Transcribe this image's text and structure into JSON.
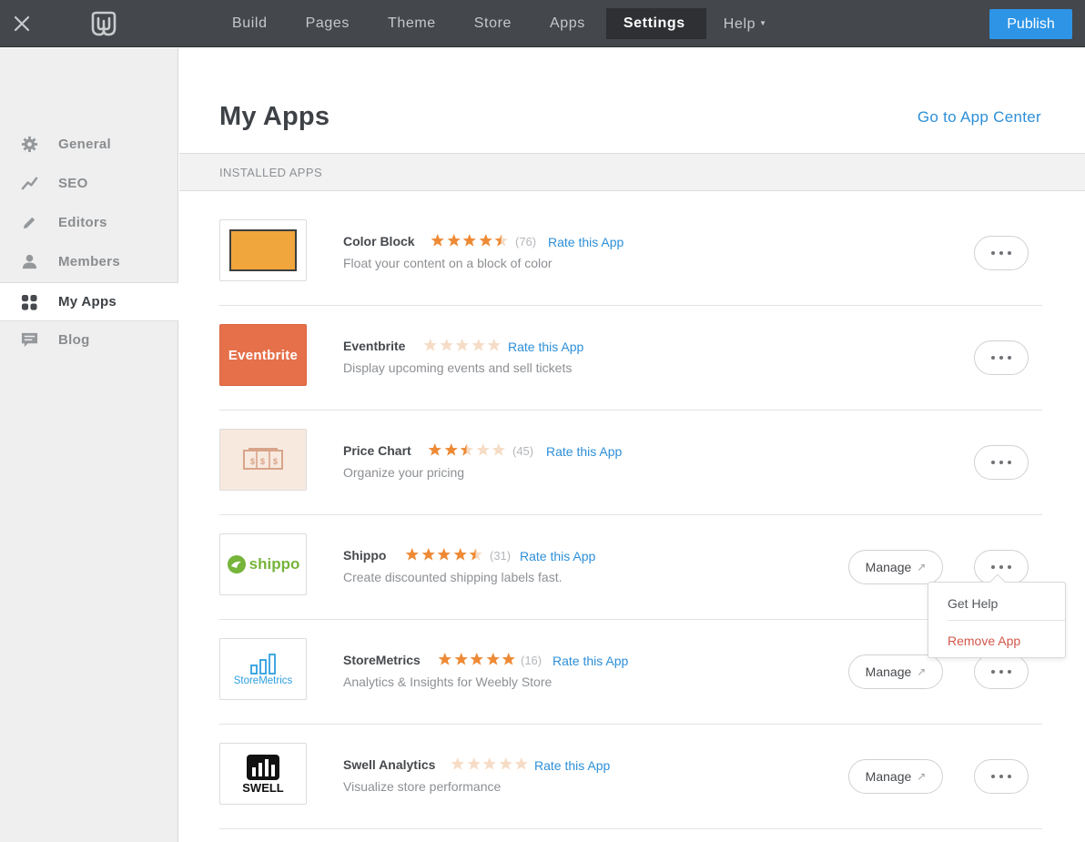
{
  "topbar": {
    "nav": [
      {
        "label": "Build",
        "active": false
      },
      {
        "label": "Pages",
        "active": false
      },
      {
        "label": "Theme",
        "active": false
      },
      {
        "label": "Store",
        "active": false
      },
      {
        "label": "Apps",
        "active": false
      },
      {
        "label": "Settings",
        "active": true
      },
      {
        "label": "Help",
        "active": false
      }
    ],
    "publish_label": "Publish",
    "colors": {
      "bar": "#44474b",
      "publish": "#2d94e6"
    }
  },
  "sidebar": {
    "items": [
      {
        "label": "General",
        "icon": "gear-icon",
        "active": false
      },
      {
        "label": "SEO",
        "icon": "trend-icon",
        "active": false
      },
      {
        "label": "Editors",
        "icon": "pencil-icon",
        "active": false
      },
      {
        "label": "Members",
        "icon": "person-icon",
        "active": false
      },
      {
        "label": "My Apps",
        "icon": "grid-icon",
        "active": true
      },
      {
        "label": "Blog",
        "icon": "speech-bubble-icon",
        "active": false
      }
    ]
  },
  "main": {
    "title": "My Apps",
    "app_center_link": "Go to App Center",
    "section_label": "INSTALLED APPS",
    "apps": [
      {
        "name": "Color Block",
        "rating": 4.5,
        "count": "(76)",
        "rate_label": "Rate this App",
        "description": "Float your content on a block of color",
        "has_manage": false,
        "logo_text": ""
      },
      {
        "name": "Eventbrite",
        "rating": 0,
        "count": "",
        "rate_label": "Rate this App",
        "description": "Display upcoming events and sell tickets",
        "has_manage": false,
        "logo_text": "Eventbrite"
      },
      {
        "name": "Price Chart",
        "rating": 2.5,
        "count": "(45)",
        "rate_label": "Rate this App",
        "description": "Organize your pricing",
        "has_manage": false,
        "logo_text": "$ $ $"
      },
      {
        "name": "Shippo",
        "rating": 4.5,
        "count": "(31)",
        "rate_label": "Rate this App",
        "description": "Create discounted shipping labels fast.",
        "has_manage": true,
        "logo_text": "shippo"
      },
      {
        "name": "StoreMetrics",
        "rating": 5,
        "count": "(16)",
        "rate_label": "Rate this App",
        "description": "Analytics & Insights for Weebly Store",
        "has_manage": true,
        "logo_text": "StoreMetrics"
      },
      {
        "name": "Swell Analytics",
        "rating": 0,
        "count": "",
        "rate_label": "Rate this App",
        "description": "Visualize store performance",
        "has_manage": true,
        "logo_text": "SWELL"
      }
    ],
    "manage_label": "Manage",
    "colors": {
      "link": "#2d8fd8",
      "star_filled": "#ee8a35",
      "star_empty": "#f6dcc6"
    }
  },
  "dropdown": {
    "items": [
      "Get Help",
      "Remove App"
    ]
  }
}
